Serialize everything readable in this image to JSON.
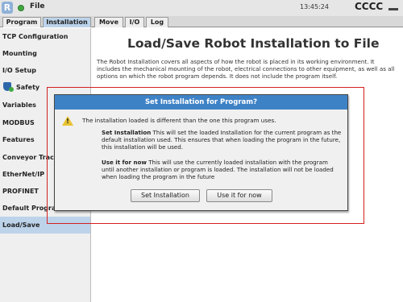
{
  "header": {
    "logo": "R",
    "menu_label": "File",
    "time": "13:45:24",
    "robot_name": "CCCC"
  },
  "tabs": [
    {
      "label": "Program",
      "active": false
    },
    {
      "label": "Installation",
      "active": true
    },
    {
      "label": "Move",
      "active": false
    },
    {
      "label": "I/O",
      "active": false
    },
    {
      "label": "Log",
      "active": false
    }
  ],
  "sidebar": {
    "items": [
      {
        "label": "TCP Configuration"
      },
      {
        "label": "Mounting"
      },
      {
        "label": "I/O Setup"
      },
      {
        "label": "Safety"
      },
      {
        "label": "Variables"
      },
      {
        "label": "MODBUS"
      },
      {
        "label": "Features"
      },
      {
        "label": "Conveyor Trac"
      },
      {
        "label": "EtherNet/IP"
      },
      {
        "label": "PROFINET"
      },
      {
        "label": "Default Program"
      },
      {
        "label": "Load/Save",
        "active": true
      }
    ]
  },
  "main": {
    "title": "Load/Save Robot Installation to File",
    "description": "The Robot Installation covers all aspects of how the robot is placed in its working environment. It includes the mechanical mounting of the robot, electrical connections to other equipment, as well as all options on which the robot program depends. It does not include the program itself."
  },
  "dialog": {
    "title": "Set Installation for Program?",
    "message": "The installation loaded is different than the one this program uses.",
    "set_heading": "Set Installation",
    "set_text": " This will set the loaded Installation for the current program as the default installation used. This ensures that when loading the program in the future, this installation will be used.",
    "use_heading": "Use it for now",
    "use_text": " This will use the currently loaded installation with the program until another installation or program is loaded. The installation will not be loaded when loading the program in the future",
    "buttons": {
      "set": "Set Installation",
      "use": "Use it for now"
    }
  },
  "colors": {
    "accent": "#3e82c6",
    "active_tab": "#bcd3ea",
    "highlight": "#d42020",
    "warning": "#e8c330",
    "status": "#3fa83f"
  }
}
